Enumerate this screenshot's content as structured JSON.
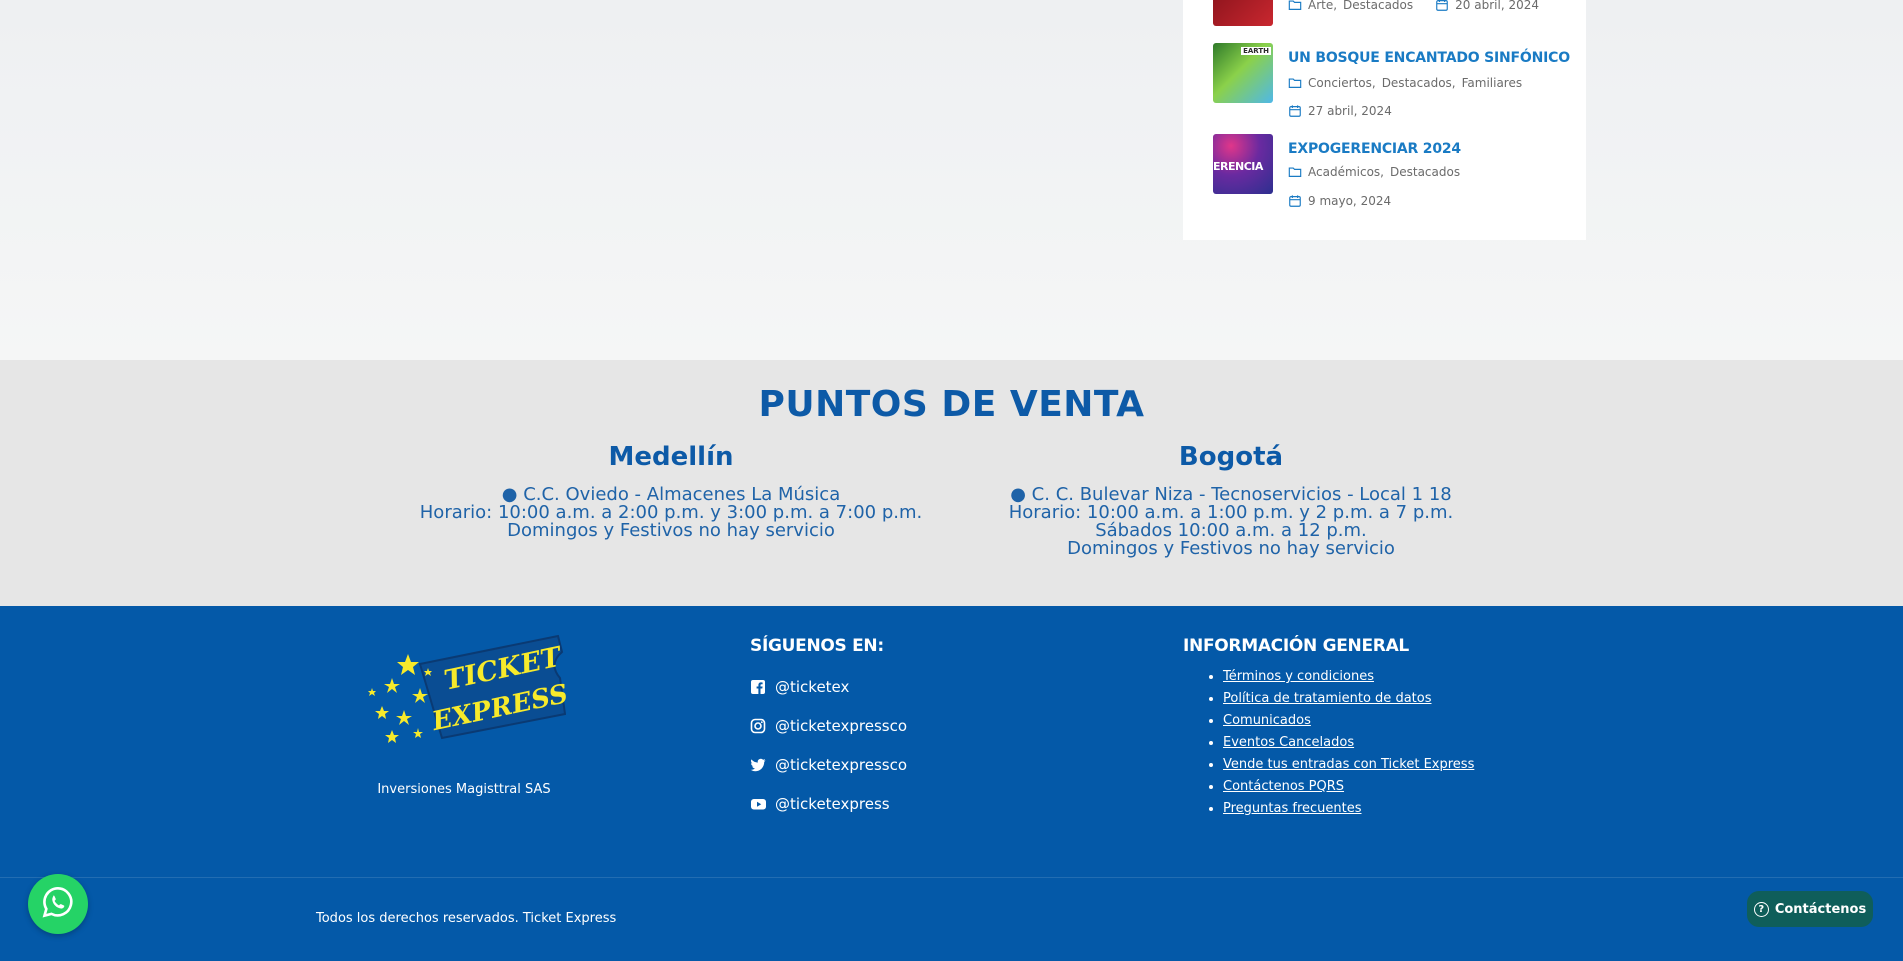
{
  "events": [
    {
      "title": "",
      "categories": [
        "Arte,",
        "Destacados"
      ],
      "date": "20 abril, 2024",
      "thumb_color": "#b5202a"
    },
    {
      "title": "UN BOSQUE ENCANTADO SINFÓNICO",
      "categories": [
        "Conciertos,",
        "Destacados,",
        "Familiares"
      ],
      "date": "27 abril, 2024",
      "thumb_color": "#7ac943"
    },
    {
      "title": "EXPOGERENCIAR 2024",
      "categories": [
        "Académicos,",
        "Destacados"
      ],
      "date": "9 mayo, 2024",
      "thumb_color": "#5b2c8f",
      "thumb_text": "ERENCIA"
    }
  ],
  "puntos": {
    "title": "PUNTOS DE VENTA",
    "medellin": {
      "name": "Medellín",
      "lines": [
        "● C.C. Oviedo - Almacenes La Música",
        "Horario: 10:00 a.m. a 2:00 p.m. y 3:00 p.m. a 7:00 p.m.",
        "Domingos y Festivos no hay servicio"
      ]
    },
    "bogota": {
      "name": "Bogotá",
      "lines": [
        "● C. C. Bulevar Niza - Tecnoservicios - Local 1 18",
        "Horario: 10:00 a.m. a 1:00 p.m. y 2 p.m. a 7 p.m.",
        "Sábados 10:00 a.m. a 12 p.m.",
        "Domingos y Festivos no hay servicio"
      ]
    }
  },
  "footer": {
    "logo_text_1": "TICKET",
    "logo_text_2": "EXPRESS",
    "company": "Inversiones Magisttral SAS",
    "follow_title": "SÍGUENOS EN:",
    "social": [
      {
        "icon": "facebook-icon",
        "label": "@ticketex"
      },
      {
        "icon": "instagram-icon",
        "label": "@ticketexpressco"
      },
      {
        "icon": "twitter-icon",
        "label": "@ticketexpressco"
      },
      {
        "icon": "youtube-icon",
        "label": "@ticketexpress"
      }
    ],
    "info_title": "INFORMACIÓN GENERAL",
    "info_links": [
      "Términos y condiciones",
      "Política de tratamiento de datos",
      "Comunicados",
      "Eventos Cancelados",
      "Vende tus entradas con Ticket Express",
      "Contáctenos PQRS",
      "Preguntas frecuentes"
    ],
    "copyright": "Todos los derechos reservados. Ticket Express"
  },
  "contact_button": "Contáctenos",
  "colors": {
    "brand_blue": "#0459a8",
    "title_blue": "#0d5aa7",
    "link_blue": "#1a7bc4",
    "whatsapp_green": "#25d366",
    "logo_yellow": "#f7ea2b"
  }
}
